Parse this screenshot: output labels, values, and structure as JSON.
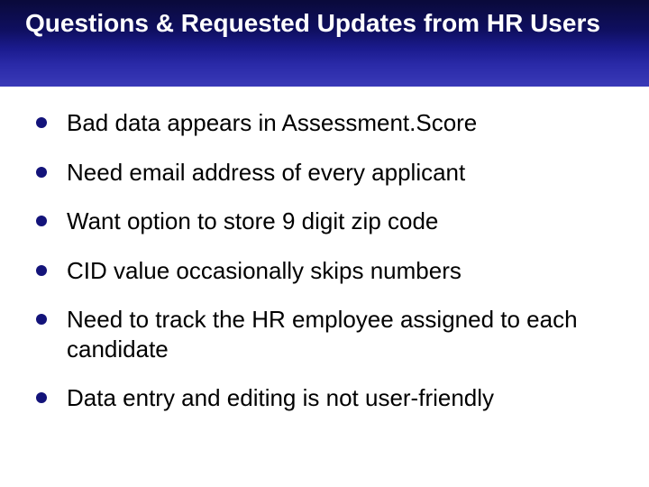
{
  "title": "Questions & Requested Updates from HR Users",
  "bullets": [
    "Bad data appears in Assessment.Score",
    "Need email address of every applicant",
    "Want option to store 9 digit zip code",
    "CID value occasionally skips numbers",
    "Need to track the HR employee assigned to each candidate",
    "Data entry and editing is not user-friendly"
  ]
}
